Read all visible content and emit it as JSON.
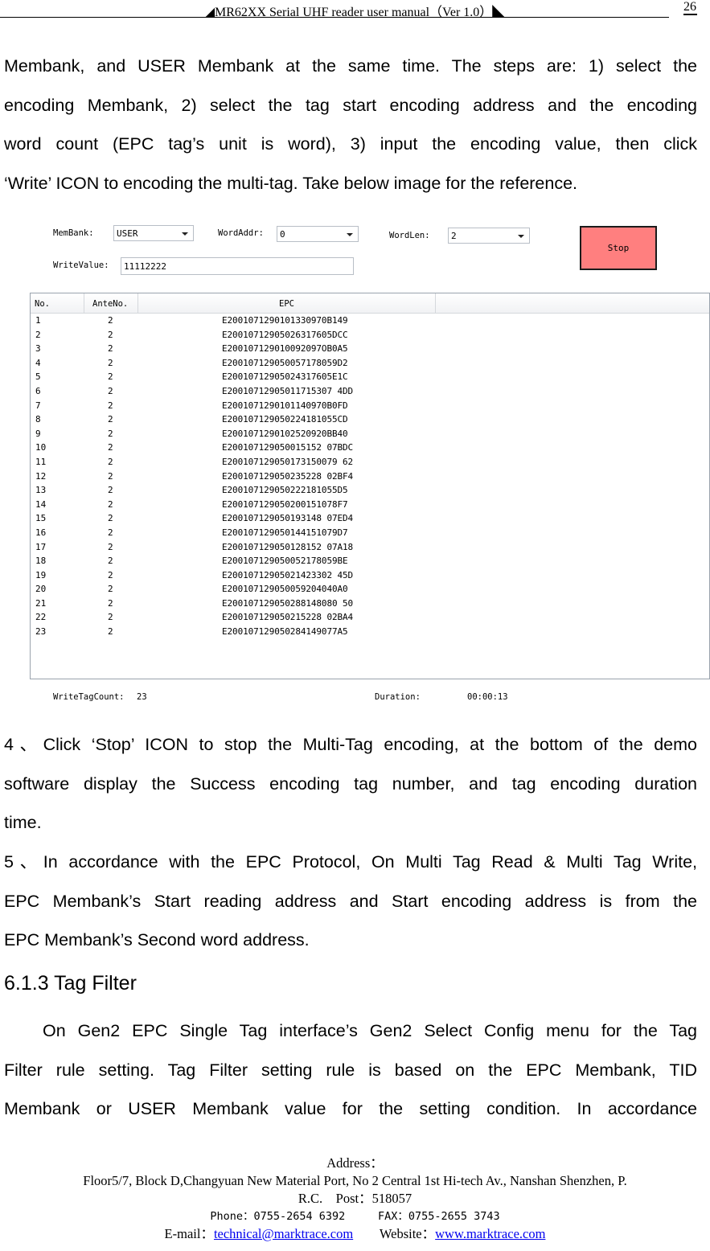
{
  "header": {
    "title": "◢MR62XX Serial UHF reader user manual（Ver 1.0）◣",
    "page_number": "26"
  },
  "intro_paragraph": {
    "lines": [
      "Membank, and USER Membank at the same time. The steps are: 1) select the",
      "encoding Membank, 2) select the tag start encoding address and the encoding",
      "word count (EPC tag’s unit is word), 3) input the encoding value, then click",
      "‘Write’ ICON to encoding the multi-tag. Take below image for the reference."
    ]
  },
  "app": {
    "membank_label": "MemBank:",
    "membank_value": "USER",
    "wordaddr_label": "WordAddr:",
    "wordaddr_value": "0",
    "wordlen_label": "WordLen:",
    "wordlen_value": "2",
    "writevalue_label": "WriteValue:",
    "writevalue_value": "11112222",
    "stop_button": "Stop",
    "stop_button_color": "#ff7f7f",
    "columns": [
      "No.",
      "AnteNo.",
      "EPC"
    ],
    "rows": [
      {
        "no": "1",
        "ante": "2",
        "epc": "E2001071290101330970B149"
      },
      {
        "no": "2",
        "ante": "2",
        "epc": "E20010712905026317605DCC"
      },
      {
        "no": "3",
        "ante": "2",
        "epc": "E200107129010092097OB0A5"
      },
      {
        "no": "4",
        "ante": "2",
        "epc": "E200107129050057178059D2"
      },
      {
        "no": "5",
        "ante": "2",
        "epc": "E20010712905024317605E1C"
      },
      {
        "no": "6",
        "ante": "2",
        "epc": "E20010712905011715307 4DD"
      },
      {
        "no": "7",
        "ante": "2",
        "epc": "E2001071290101140970B0FD"
      },
      {
        "no": "8",
        "ante": "2",
        "epc": "E200107129050224181055CD"
      },
      {
        "no": "9",
        "ante": "2",
        "epc": "E2001071290102520920BB40"
      },
      {
        "no": "10",
        "ante": "2",
        "epc": "E200107129050015152 07BDC"
      },
      {
        "no": "11",
        "ante": "2",
        "epc": "E200107129050173150079 62"
      },
      {
        "no": "12",
        "ante": "2",
        "epc": "E200107129050235228 02BF4"
      },
      {
        "no": "13",
        "ante": "2",
        "epc": "E200107129050222181055D5"
      },
      {
        "no": "14",
        "ante": "2",
        "epc": "E200107129050200151078F7"
      },
      {
        "no": "15",
        "ante": "2",
        "epc": "E200107129050193148 07ED4"
      },
      {
        "no": "16",
        "ante": "2",
        "epc": "E200107129050144151079D7"
      },
      {
        "no": "17",
        "ante": "2",
        "epc": "E200107129050128152 07A18"
      },
      {
        "no": "18",
        "ante": "2",
        "epc": "E200107129050052178059BE"
      },
      {
        "no": "19",
        "ante": "2",
        "epc": "E20010712905021423302 45D"
      },
      {
        "no": "20",
        "ante": "2",
        "epc": "E200107129050059204040A0"
      },
      {
        "no": "21",
        "ante": "2",
        "epc": "E200107129050288148080 50"
      },
      {
        "no": "22",
        "ante": "2",
        "epc": "E200107129050215228 02BA4"
      },
      {
        "no": "23",
        "ante": "2",
        "epc": "E200107129050284149077A5"
      }
    ],
    "write_tag_count_label": "WriteTagCount:",
    "write_tag_count_value": "23",
    "duration_label": "Duration:",
    "duration_value": "00:00:13"
  },
  "step4": {
    "lines": [
      "4、Click ‘Stop’ ICON to stop the Multi-Tag encoding, at the bottom of the demo",
      "software display the Success encoding tag number, and tag encoding duration",
      "time."
    ]
  },
  "step5": {
    "lines": [
      "5、In accordance with the EPC Protocol, On Multi Tag Read & Multi Tag Write,",
      "EPC Membank’s Start reading address and Start encoding address is from the",
      "EPC Membank’s Second word address."
    ]
  },
  "section": {
    "heading": "6.1.3 Tag Filter",
    "lines": [
      "On Gen2 EPC Single Tag interface’s Gen2 Select Config menu for the Tag",
      "Filter rule setting. Tag Filter setting rule is based on the EPC Membank, TID",
      "Membank or USER Membank value for the setting condition. In accordance"
    ]
  },
  "footer": {
    "address_label": "Address：",
    "address_line": "Floor5/7, Block D,Changyuan New  Material Port, No 2 Central 1st Hi-tech Av., Nanshan Shenzhen, P.",
    "address_line2": "R.C.",
    "post": "Post：518057",
    "phone": "Phone：0755-2654 6392",
    "fax": "FAX：0755-2655 3743",
    "email_label": "E-mail：",
    "email": "technical@marktrace.com",
    "website_label": "Website：",
    "website": "www.marktrace.com"
  }
}
